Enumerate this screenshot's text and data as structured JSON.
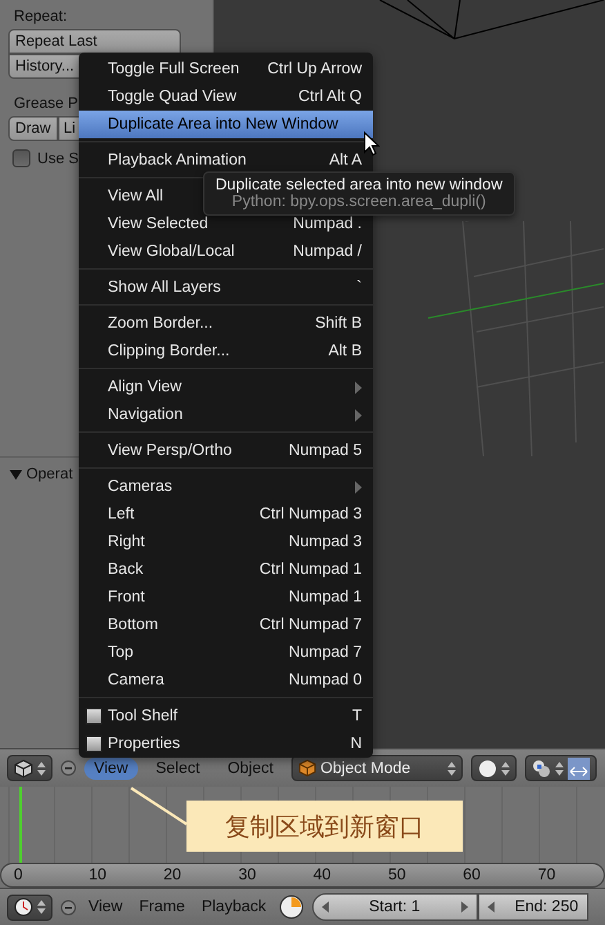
{
  "tool_panel": {
    "repeat_label": "Repeat:",
    "buttons": [
      "Repeat Last",
      "History..."
    ],
    "grease_label": "Grease P",
    "grease_buttons": [
      "Draw",
      "Li"
    ],
    "sketch_checkbox": {
      "label": "Use S",
      "checked": false
    },
    "operator_panel": {
      "label": "Operat",
      "expanded": true
    }
  },
  "view_menu": {
    "items": [
      {
        "kind": "item",
        "label": "Toggle Full Screen",
        "shortcut": "Ctrl Up Arrow",
        "selected": false
      },
      {
        "kind": "item",
        "label": "Toggle Quad View",
        "shortcut": "Ctrl Alt Q",
        "selected": false
      },
      {
        "kind": "item",
        "label": "Duplicate Area into New Window",
        "selected": true
      },
      {
        "kind": "separator"
      },
      {
        "kind": "item",
        "label": "Playback Animation",
        "shortcut": "Alt A",
        "selected": false
      },
      {
        "kind": "separator"
      },
      {
        "kind": "item",
        "label": "View All",
        "selected": false
      },
      {
        "kind": "item",
        "label": "View Selected",
        "shortcut": "Numpad .",
        "selected": false
      },
      {
        "kind": "item",
        "label": "View Global/Local",
        "shortcut": "Numpad /",
        "selected": false
      },
      {
        "kind": "separator"
      },
      {
        "kind": "item",
        "label": "Show All Layers",
        "shortcut": "`",
        "selected": false
      },
      {
        "kind": "separator"
      },
      {
        "kind": "item",
        "label": "Zoom Border...",
        "shortcut": "Shift B",
        "selected": false
      },
      {
        "kind": "item",
        "label": "Clipping Border...",
        "shortcut": "Alt B",
        "selected": false
      },
      {
        "kind": "separator"
      },
      {
        "kind": "submenu",
        "label": "Align View",
        "selected": false
      },
      {
        "kind": "submenu",
        "label": "Navigation",
        "selected": false
      },
      {
        "kind": "separator"
      },
      {
        "kind": "item",
        "label": "View Persp/Ortho",
        "shortcut": "Numpad 5",
        "selected": false
      },
      {
        "kind": "separator"
      },
      {
        "kind": "submenu",
        "label": "Cameras",
        "selected": false
      },
      {
        "kind": "item",
        "label": "Left",
        "shortcut": "Ctrl Numpad 3",
        "selected": false
      },
      {
        "kind": "item",
        "label": "Right",
        "shortcut": "Numpad 3",
        "selected": false
      },
      {
        "kind": "item",
        "label": "Back",
        "shortcut": "Ctrl Numpad 1",
        "selected": false
      },
      {
        "kind": "item",
        "label": "Front",
        "shortcut": "Numpad 1",
        "selected": false
      },
      {
        "kind": "item",
        "label": "Bottom",
        "shortcut": "Ctrl Numpad 7",
        "selected": false
      },
      {
        "kind": "item",
        "label": "Top",
        "shortcut": "Numpad 7",
        "selected": false
      },
      {
        "kind": "item",
        "label": "Camera",
        "shortcut": "Numpad 0",
        "selected": false
      },
      {
        "kind": "separator"
      },
      {
        "kind": "toggle",
        "label": "Tool Shelf",
        "shortcut": "T",
        "checked": false,
        "selected": false
      },
      {
        "kind": "toggle",
        "label": "Properties",
        "shortcut": "N",
        "checked": false,
        "selected": false
      }
    ]
  },
  "tooltip": {
    "description": "Duplicate selected area into new window",
    "python": "Python: bpy.ops.screen.area_dupli()"
  },
  "header": {
    "menus": [
      {
        "label": "View",
        "selected": true
      },
      {
        "label": "Select",
        "selected": false
      },
      {
        "label": "Object",
        "selected": false
      }
    ],
    "mode": "Object Mode"
  },
  "callout": {
    "text": "复制区域到新窗口"
  },
  "timeline": {
    "ruler": [
      "0",
      "10",
      "20",
      "30",
      "40",
      "50",
      "60",
      "70"
    ]
  },
  "footer": {
    "menus": [
      "View",
      "Frame",
      "Playback"
    ],
    "start": "Start: 1",
    "end": "End: 250"
  }
}
